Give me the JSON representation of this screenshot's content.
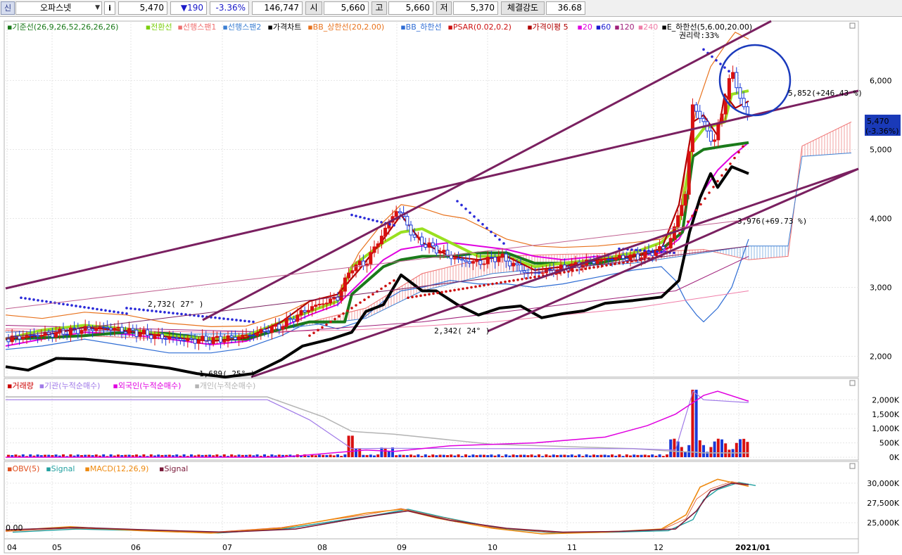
{
  "header": {
    "code_icon": "신",
    "stock_name": "오파스넷",
    "info_label": "i",
    "price": "5,470",
    "change": "▼190",
    "change_pct": "-3.36%",
    "volume": "146,747",
    "open_label": "시",
    "open_value": "5,660",
    "high_label": "고",
    "high_value": "5,660",
    "low_label": "저",
    "low_value": "5,370",
    "strength_label": "체결강도",
    "strength_value": "36.68"
  },
  "price_panel": {
    "legend": [
      {
        "text": "기준선(26,9,26,52,26,26,26)",
        "color": "#1a7a1a"
      },
      {
        "text": "전환선",
        "color": "#7ccf10"
      },
      {
        "text": "선행스팬1",
        "color": "#ef6f6f"
      },
      {
        "text": "선행스팬2",
        "color": "#3c7fd2"
      },
      {
        "text": "가격차트",
        "color": "#000000"
      },
      {
        "text": "BB_상한선(20,2.00)",
        "color": "#e8731e"
      },
      {
        "text": "BB_하한선",
        "color": "#2f6dd4"
      },
      {
        "text": "PSAR(0.02,0.2)",
        "color": "#cc1111"
      },
      {
        "text": "가격이평 5",
        "color": "#b00000"
      },
      {
        "text": "20",
        "color": "#e000e0"
      },
      {
        "text": "60",
        "color": "#1b1bd0"
      },
      {
        "text": "120",
        "color": "#a0207a"
      },
      {
        "text": "240",
        "color": "#f07da8"
      },
      {
        "text": "E_하한선(5,6.00,20.00)",
        "color": "#000000"
      }
    ],
    "annotations": {
      "rights_drop": "권리락:33%",
      "line_label_1": "5,852(+246.43 %)",
      "line_label_2": "3,976(+69.73 %)",
      "pivot_1": "2,732( 27° )",
      "pivot_2": "2,342( 24° )",
      "pivot_3": "1,689( 25° )",
      "current_price": "5,470",
      "current_pct": "(-3.36%)"
    },
    "y_ticks": [
      "6,000",
      "5,000",
      "4,000",
      "3,000",
      "2,000"
    ]
  },
  "volume_panel": {
    "legend": [
      {
        "text": "거래량",
        "color": "#cc0000"
      },
      {
        "text": "기관(누적순매수)",
        "color": "#a07ae8"
      },
      {
        "text": "외국인(누적순매수)",
        "color": "#e000e0"
      },
      {
        "text": "개인(누적순매수)",
        "color": "#b4b4b4"
      }
    ],
    "y_ticks": [
      "2,000K",
      "1,500K",
      "1,000K",
      "500K",
      "0K"
    ]
  },
  "obv_panel": {
    "legend": [
      {
        "text": "OBV(5)",
        "color": "#e05020"
      },
      {
        "text": "Signal",
        "color": "#22a0a0"
      },
      {
        "text": "MACD(12,26,9)",
        "color": "#ee8a10"
      },
      {
        "text": "Signal",
        "color": "#7a1a3a"
      }
    ],
    "left_value": "0.00",
    "y_ticks": [
      "30,000K",
      "27,500K",
      "25,000K"
    ]
  },
  "x_axis": {
    "labels": [
      "04",
      "05",
      "06",
      "07",
      "08",
      "09",
      "10",
      "11",
      "12",
      "2021/01"
    ]
  },
  "chart_data": {
    "type": "line",
    "title": "오파스넷",
    "x": [
      "2020-04",
      "2020-05",
      "2020-06",
      "2020-07",
      "2020-08",
      "2020-09",
      "2020-10",
      "2020-11",
      "2020-12",
      "2021-01"
    ],
    "series": [
      {
        "name": "가격차트",
        "values": [
          2250,
          2350,
          2300,
          2150,
          2900,
          3700,
          3350,
          3250,
          3500,
          5470
        ]
      },
      {
        "name": "E_하한선(5,6.00,20.00)",
        "values": [
          1850,
          2000,
          1900,
          1700,
          2300,
          3000,
          2700,
          2600,
          2800,
          4650
        ]
      },
      {
        "name": "BB_상한선(20,2.00)",
        "values": [
          2550,
          2600,
          2450,
          2400,
          3000,
          4200,
          3600,
          3500,
          3600,
          6600
        ]
      },
      {
        "name": "20",
        "values": [
          2200,
          2300,
          2350,
          2250,
          2700,
          3500,
          3550,
          3350,
          3450,
          5100
        ]
      }
    ],
    "ylim": [
      1700,
      6800
    ],
    "volume_ylim": [
      0,
      2400000
    ],
    "obv_ylim": [
      23500000,
      31500000
    ]
  }
}
